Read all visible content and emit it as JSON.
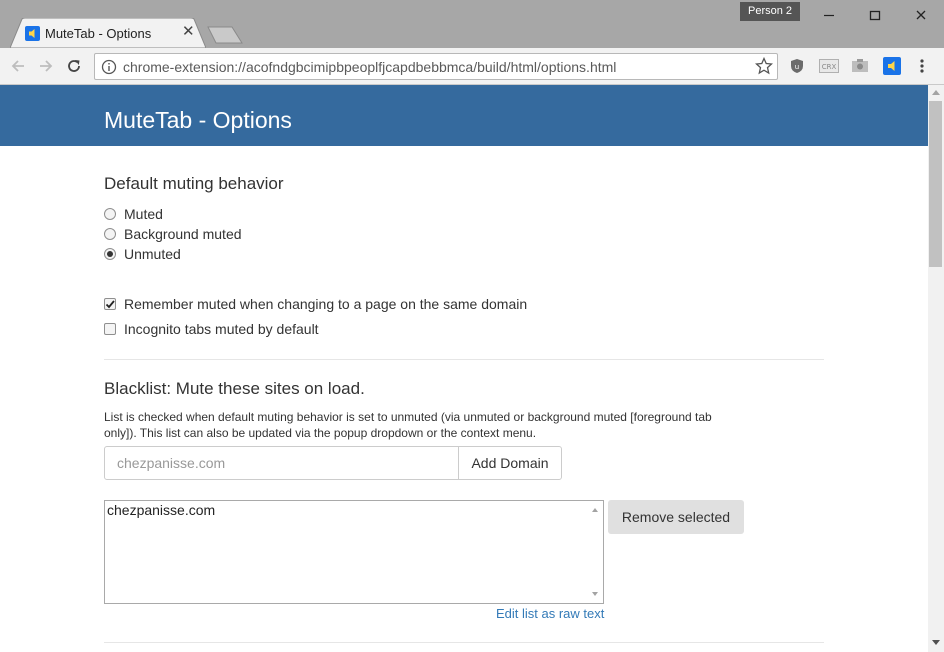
{
  "browser": {
    "profile_label": "Person 2",
    "tab_title": "MuteTab - Options",
    "url": "chrome-extension://acofndgbcimipbpeoplfjcapdbebbmca/build/html/options.html"
  },
  "page": {
    "title": "MuteTab - Options",
    "muting_heading": "Default muting behavior",
    "muting_options": [
      "Muted",
      "Background muted",
      "Unmuted"
    ],
    "muting_selected": "Unmuted",
    "remember_label": "Remember muted when changing to a page on the same domain",
    "remember_checked": true,
    "incognito_label": "Incognito tabs muted by default",
    "incognito_checked": false,
    "blacklist_heading": "Blacklist: Mute these sites on load.",
    "blacklist_help": "List is checked when default muting behavior is set to unmuted (via unmuted or background muted [foreground tab only]). This list can also be updated via the popup dropdown or the context menu.",
    "domain_placeholder": "chezpanisse.com",
    "add_domain_label": "Add Domain",
    "blacklist_items": [
      "chezpanisse.com"
    ],
    "remove_selected_label": "Remove selected",
    "edit_raw_label": "Edit list as raw text"
  },
  "colors": {
    "header_band": "#356a9e",
    "link": "#337ab7"
  }
}
